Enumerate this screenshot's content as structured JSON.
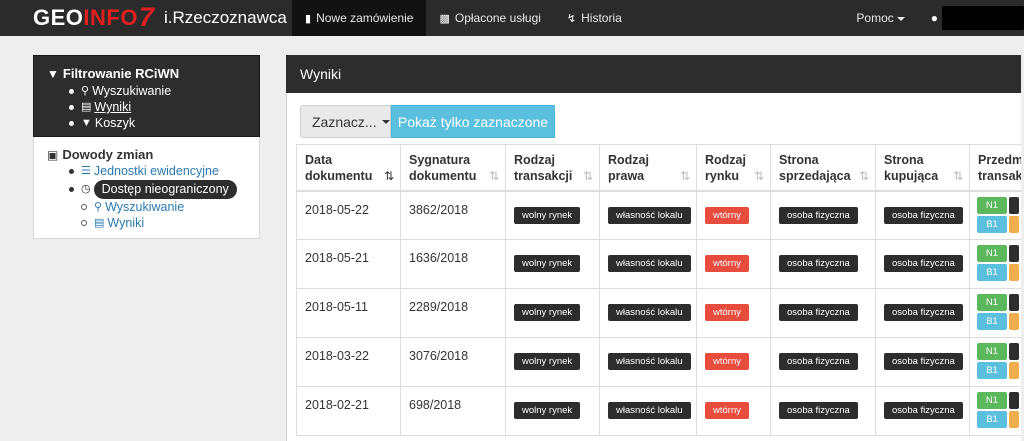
{
  "navbar": {
    "brand_geo": "GEO",
    "brand_info": "INFO",
    "brand_seven": "7",
    "brand_sub": "i.Rzeczoznawca",
    "items": [
      {
        "label": "Nowe zamówienie",
        "icon": "document-icon",
        "active": true
      },
      {
        "label": "Opłacone usługi",
        "icon": "money-icon",
        "active": false
      },
      {
        "label": "Historia",
        "icon": "bolt-icon",
        "active": false
      }
    ],
    "help_label": "Pomoc"
  },
  "filter": {
    "title": "Filtrowanie RCiWN",
    "items": [
      {
        "label": "Wyszukiwanie",
        "icon": "search-icon"
      },
      {
        "label": "Wyniki",
        "icon": "list-icon"
      },
      {
        "label": "Koszyk",
        "icon": "cart-icon"
      }
    ]
  },
  "evidence": {
    "title": "Dowody zmian",
    "items": [
      {
        "label": "Jednostki ewidencyjne",
        "icon": "database-icon"
      },
      {
        "label": "Dostęp nieograniczony",
        "icon": "clock-icon"
      }
    ],
    "sub_items": [
      {
        "label": "Wyszukiwanie",
        "icon": "search-icon"
      },
      {
        "label": "Wyniki",
        "icon": "list-icon"
      }
    ]
  },
  "results": {
    "title": "Wyniki",
    "select_label": "Zaznacz...",
    "show_selected_label": "Pokaż tylko zaznaczone",
    "columns": [
      {
        "line1": "Data",
        "line2": "dokumentu"
      },
      {
        "line1": "Sygnatura",
        "line2": "dokumentu"
      },
      {
        "line1": "Rodzaj",
        "line2": "transakcji"
      },
      {
        "line1": "Rodzaj",
        "line2": "prawa"
      },
      {
        "line1": "Rodzaj",
        "line2": "rynku"
      },
      {
        "line1": "Strona",
        "line2": "sprzedająca"
      },
      {
        "line1": "Strona",
        "line2": "kupująca"
      },
      {
        "line1": "Przedm",
        "line2": "transak"
      }
    ],
    "rows": [
      {
        "date": "2018-05-22",
        "signature": "3862/2018",
        "transaction": "wolny rynek",
        "right": "własność lokalu",
        "market": "wtórny",
        "seller": "osoba fizyczna",
        "buyer": "osoba fizyczna",
        "obj1": "N1",
        "obj2": "B1"
      },
      {
        "date": "2018-05-21",
        "signature": "1636/2018",
        "transaction": "wolny rynek",
        "right": "własność lokalu",
        "market": "wtórny",
        "seller": "osoba fizyczna",
        "buyer": "osoba fizyczna",
        "obj1": "N1",
        "obj2": "B1"
      },
      {
        "date": "2018-05-11",
        "signature": "2289/2018",
        "transaction": "wolny rynek",
        "right": "własność lokalu",
        "market": "wtórny",
        "seller": "osoba fizyczna",
        "buyer": "osoba fizyczna",
        "obj1": "N1",
        "obj2": "B1"
      },
      {
        "date": "2018-03-22",
        "signature": "3076/2018",
        "transaction": "wolny rynek",
        "right": "własność lokalu",
        "market": "wtórny",
        "seller": "osoba fizyczna",
        "buyer": "osoba fizyczna",
        "obj1": "N1",
        "obj2": "B1"
      },
      {
        "date": "2018-02-21",
        "signature": "698/2018",
        "transaction": "wolny rynek",
        "right": "własność lokalu",
        "market": "wtórny",
        "seller": "osoba fizyczna",
        "buyer": "osoba fizyczna",
        "obj1": "N1",
        "obj2": "B1"
      }
    ]
  },
  "colors": {
    "navbar": "#2b2b2b",
    "brand_red": "#e02020",
    "info_button": "#5bc0de",
    "label_dark": "#2d2d2d",
    "label_red": "#e74c3c",
    "green": "#5cb85c",
    "orange": "#f0ad4e",
    "link": "#2a7ab0"
  }
}
